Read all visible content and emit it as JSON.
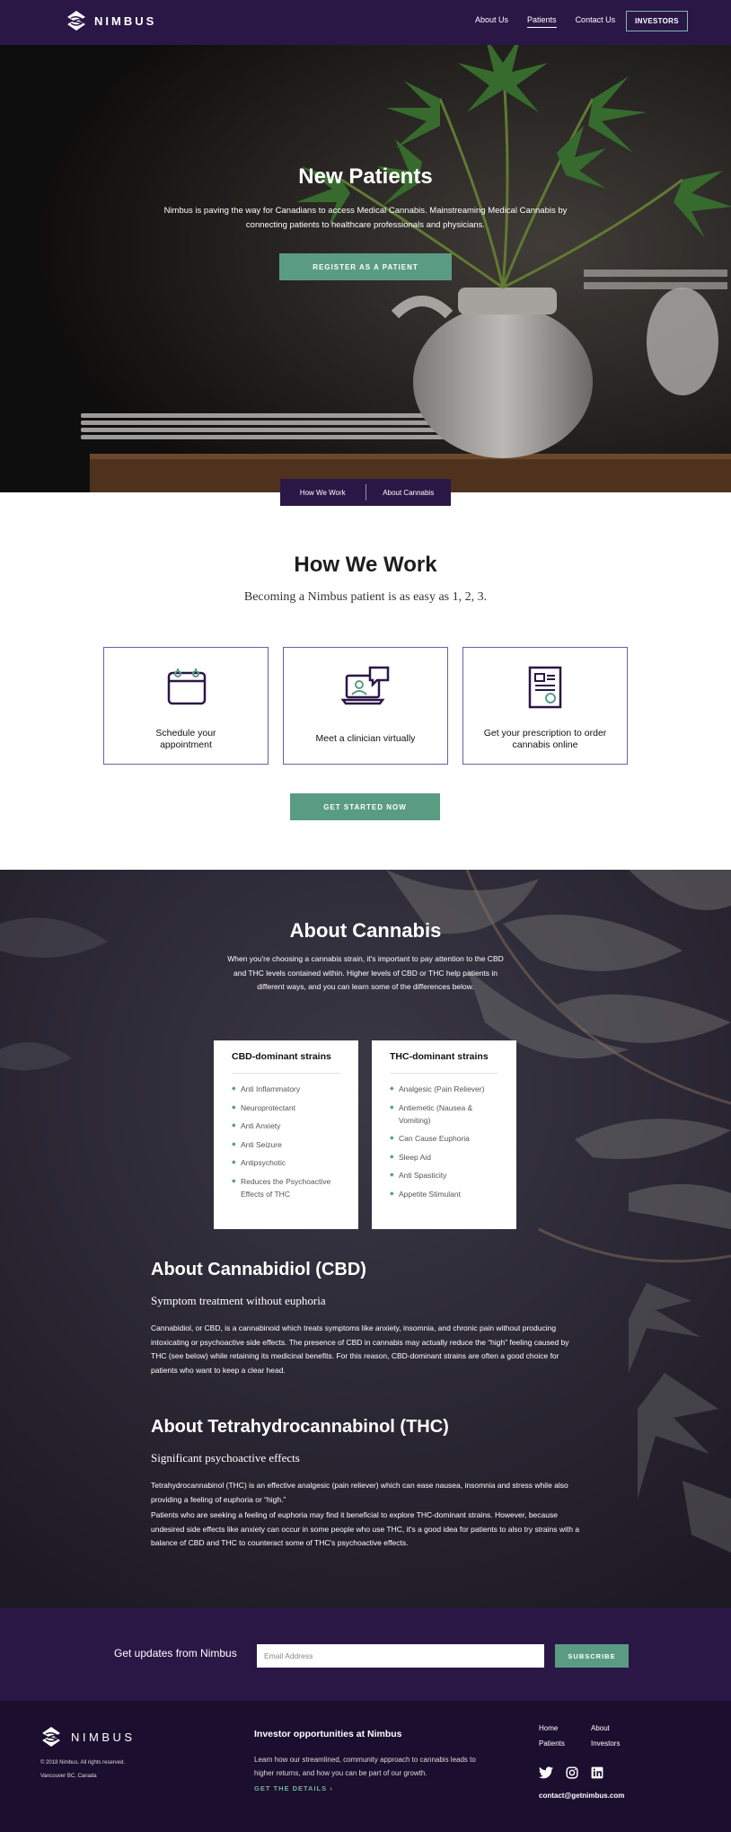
{
  "nav": {
    "brand": "NIMBUS",
    "links": [
      "About Us",
      "Patients",
      "Contact Us"
    ],
    "active": "Patients",
    "investors": "INVESTORS"
  },
  "hero": {
    "title": "New Patients",
    "text": "Nimbus is paving the way for Canadians to access Medical Cannabis.  Mainstreaming Medical Cannabis by connecting patients to healthcare professionals and physicians.",
    "button": "REGISTER AS A PATIENT"
  },
  "subnav": [
    "How We Work",
    "About Cannabis"
  ],
  "how": {
    "title": "How We Work",
    "subtitle": "Becoming a Nimbus patient is as easy as 1, 2, 3.",
    "cards": [
      {
        "label": "Schedule your appointment",
        "icon": "calendar-icon"
      },
      {
        "label": "Meet a clinician virtually",
        "icon": "laptop-chat-icon"
      },
      {
        "label": "Get your prescription to order cannabis online",
        "icon": "certificate-icon"
      }
    ],
    "button": "GET STARTED NOW"
  },
  "about": {
    "title": "About Cannabis",
    "text": "When you're choosing a cannabis strain, it's important to pay attention to the CBD and THC levels contained within. Higher levels of CBD or THC help patients in different ways, and you can learn some of the differences below.",
    "cbd_card": {
      "title": "CBD-dominant strains",
      "items": [
        "Anti Inflammatory",
        "Neuroprotectant",
        "Anti Anxiety",
        "Anti Seizure",
        "Antipsychotic",
        "Reduces the Psychoactive Effects of THC"
      ]
    },
    "thc_card": {
      "title": "THC-dominant strains",
      "items": [
        "Analgesic (Pain Reliever)",
        "Antiemetic (Nausea & Vomiting)",
        "Can Cause Euphoria",
        "Sleep Aid",
        "Anti Spasticity",
        "Appetite Stimulant"
      ]
    },
    "cbd": {
      "heading": "About Cannabidiol (CBD)",
      "subheading": "Symptom treatment without euphoria",
      "paragraph": "Cannabidiol, or CBD, is a cannabinoid which treats symptoms like anxiety, insomnia, and chronic pain without producing intoxicating or psychoactive side effects. The presence of CBD in cannabis may actually reduce the “high” feeling caused by THC (see below) while retaining its medicinal benefits. For this reason, CBD-dominant strains are often a good choice for patients who want to keep a clear head."
    },
    "thc": {
      "heading": "About Tetrahydrocannabinol (THC)",
      "subheading": "Significant psychoactive effects",
      "paragraph1": "Tetrahydrocannabinol (THC) is an effective analgesic (pain reliever) which can ease nausea, insomnia and stress while also providing a feeling of euphoria or “high.”",
      "paragraph2": "Patients who are seeking a feeling of euphoria may find it beneficial to explore THC-dominant strains. However, because undesired side effects like anxiety can occur in some people who use THC, it's a good idea for patients to also try strains with a balance of CBD and THC to counteract some of THC's psychoactive effects."
    }
  },
  "newsletter": {
    "label": "Get updates from Nimbus",
    "placeholder": "Email Address",
    "button": "SUBSCRIBE"
  },
  "footer": {
    "brand": "NIMBUS",
    "copyright": "© 2018 Nimbus. All rights reserved.",
    "location": "Vancouver BC, Canada",
    "investor_title": "Investor opportunities at Nimbus",
    "investor_text": "Learn how our streamlined, community approach to cannabis leads to higher returns, and how you can be part of our growth.",
    "investor_link": "GET THE DETAILS  ›",
    "links": [
      "Home",
      "About",
      "Patients",
      "Investors"
    ],
    "social": [
      "twitter-icon",
      "instagram-icon",
      "linkedin-icon"
    ],
    "email": "contact@getnimbus.com"
  },
  "colors": {
    "purple": "#2b1746",
    "footer": "#1b0e2e",
    "green": "#5a9c83",
    "card_border": "#6a5ea8"
  }
}
